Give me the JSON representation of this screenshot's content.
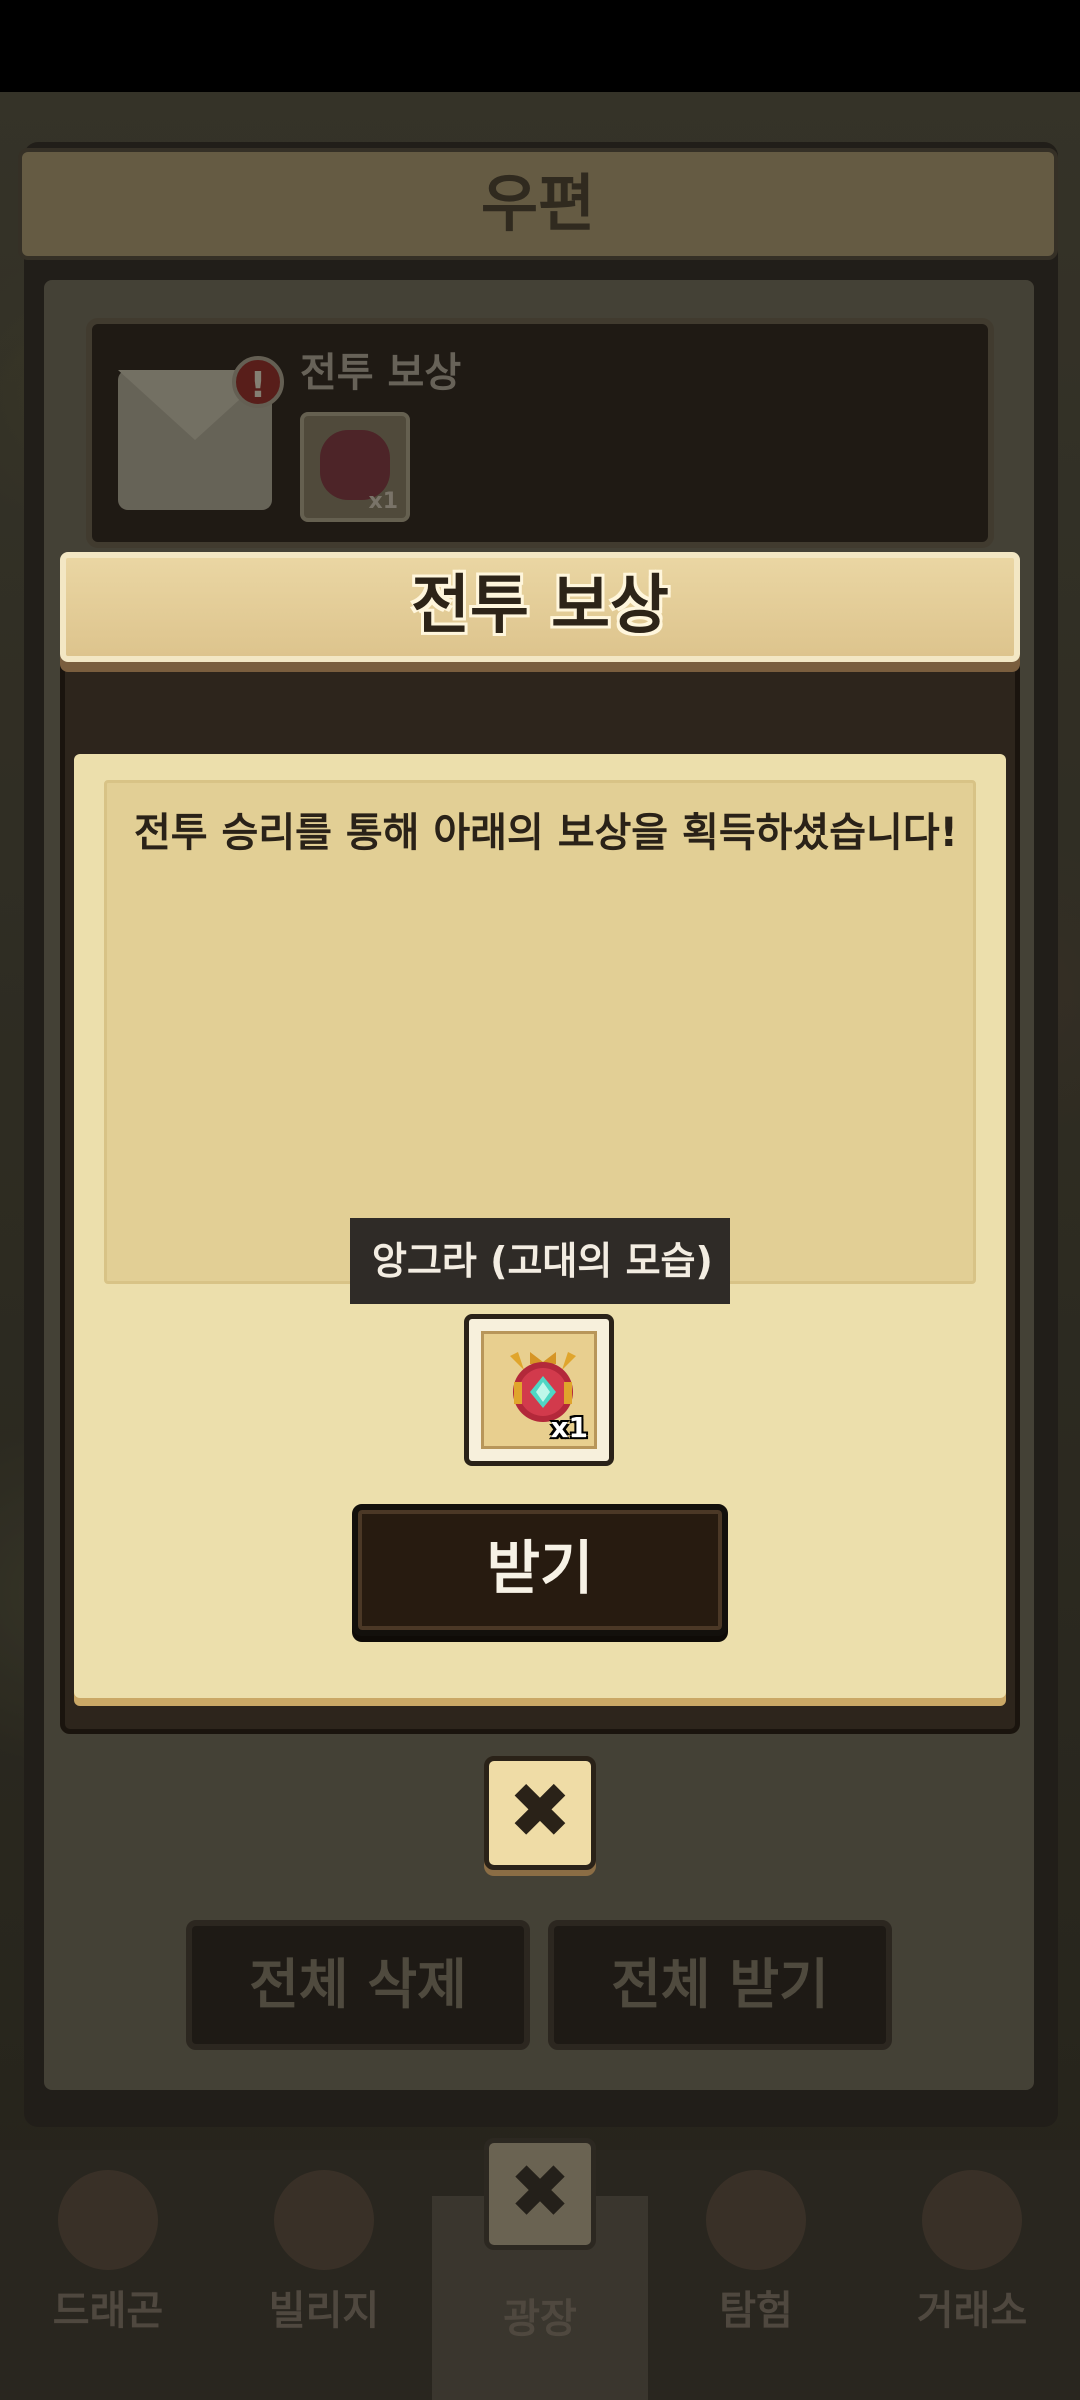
{
  "mailbox": {
    "title": "우편",
    "mail_item": {
      "title": "전투 보상",
      "alert": "!",
      "reward_qty": "x1"
    },
    "delete_all_label": "전체 삭제",
    "receive_all_label": "전체 받기",
    "close_symbol": "✖"
  },
  "bottom_nav": {
    "items": [
      {
        "label": "드래곤"
      },
      {
        "label": "빌리지"
      },
      {
        "label": "광장"
      },
      {
        "label": "탐험"
      },
      {
        "label": "거래소"
      }
    ]
  },
  "popup": {
    "title": "전투 보상",
    "message": "전투 승리를 통해 아래의 보상을 획득하셨습니다!",
    "item_name": "앙그라 (고대의 모습)",
    "item_qty": "x1",
    "receive_label": "받기",
    "close_symbol": "✖"
  },
  "colors": {
    "popup_header": "#ddc48d",
    "popup_body": "#ecdfac",
    "button_dark": "#271b10"
  }
}
